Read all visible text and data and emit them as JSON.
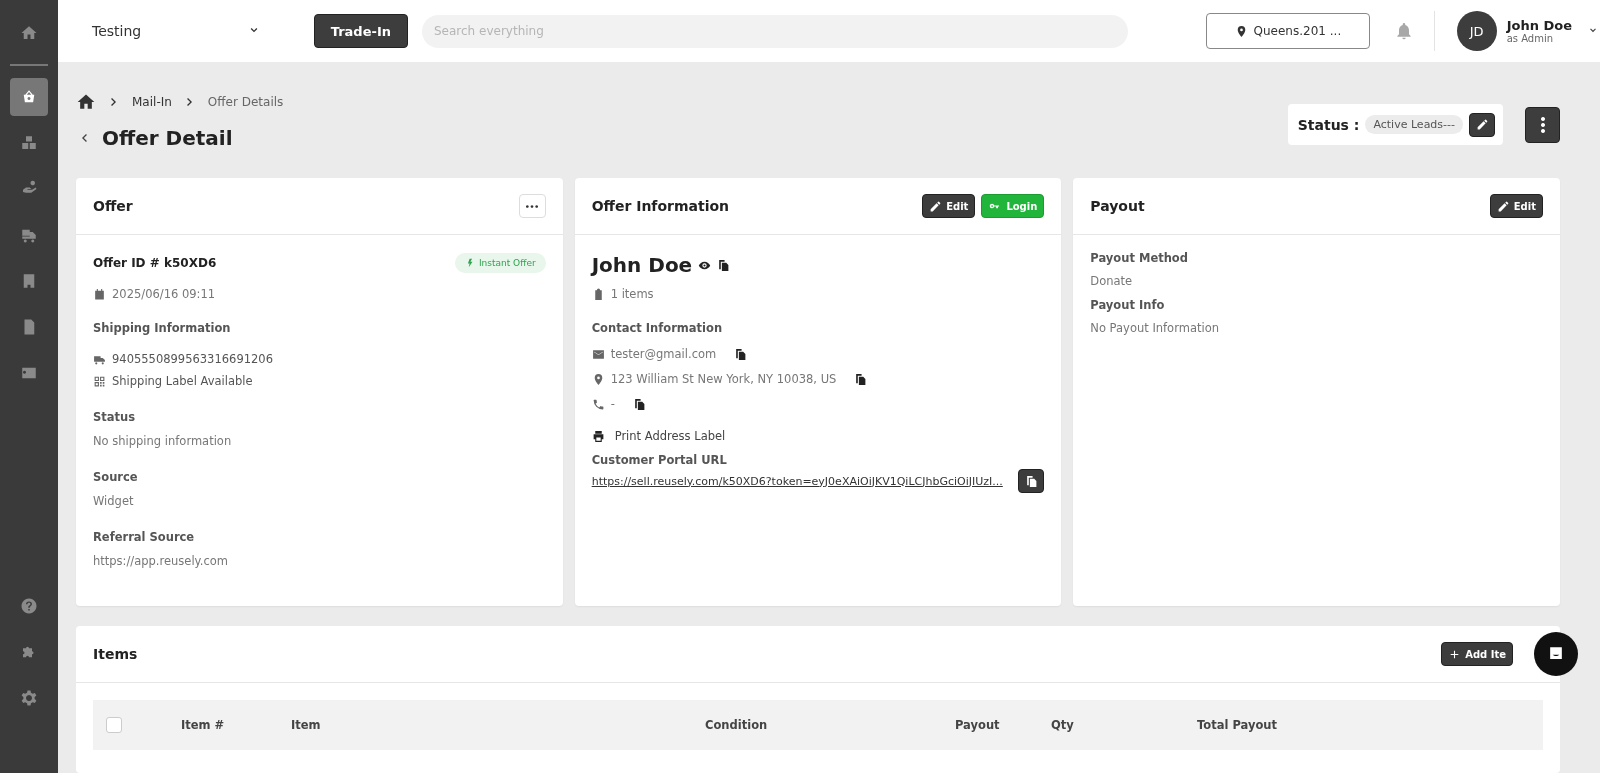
{
  "sidebar": {
    "items": [
      {
        "selected": false
      },
      {
        "selected": true
      },
      {
        "selected": false
      },
      {
        "selected": false
      },
      {
        "selected": false
      },
      {
        "selected": false
      },
      {
        "selected": false
      },
      {
        "selected": false
      }
    ],
    "bottom_items": [
      {
        "selected": false
      },
      {
        "selected": false
      },
      {
        "selected": false
      }
    ]
  },
  "topbar": {
    "store": "Testing",
    "trade_in": "Trade-In",
    "search": {
      "placeholder": "Search everything"
    },
    "location": "Queens.201 ...",
    "user": {
      "initials": "JD",
      "name": "John Doe",
      "role": "as Admin"
    }
  },
  "breadcrumb": [
    "Mail-In",
    "Offer Details"
  ],
  "page_title": "Offer Detail",
  "status": {
    "label": "Status :",
    "value": "Active Leads---"
  },
  "offer": {
    "title": "Offer",
    "offer_id": "Offer ID # k50XD6",
    "badge": "Instant Offer",
    "date": "2025/06/16 09:11",
    "shipping_heading": "Shipping Information",
    "tracking": "9405550899563316691206",
    "label_status": "Shipping Label Available",
    "fields": [
      {
        "label": "Status",
        "value": "No shipping information"
      },
      {
        "label": "Source",
        "value": "Widget"
      },
      {
        "label": "Referral Source",
        "value": "https://app.reusely.com"
      }
    ]
  },
  "offer_information": {
    "title": "Offer Information",
    "edit": "Edit",
    "login": "Login",
    "customer": "John Doe",
    "items_count": "1 items",
    "contact_heading": "Contact Information",
    "email": "tester@gmail.com",
    "address": "123 William St New York, NY 10038, US",
    "phone": "-",
    "print": "Print Address Label",
    "portal_heading": "Customer Portal URL",
    "portal_url": "https://sell.reusely.com/k50XD6?token=eyJ0eXAiOiJKV1QiLCJhbGciOiJIUzI..."
  },
  "payout": {
    "title": "Payout",
    "edit": "Edit",
    "fields": [
      {
        "label": "Payout Method",
        "value": "Donate"
      },
      {
        "label": "Payout Info",
        "value": "No Payout Information"
      }
    ]
  },
  "items": {
    "title": "Items",
    "add": "Add Ite",
    "select_all": {
      "checked": false
    },
    "columns": [
      "Item #",
      "Item",
      "Condition",
      "Payout",
      "Qty",
      "Total Payout"
    ]
  }
}
